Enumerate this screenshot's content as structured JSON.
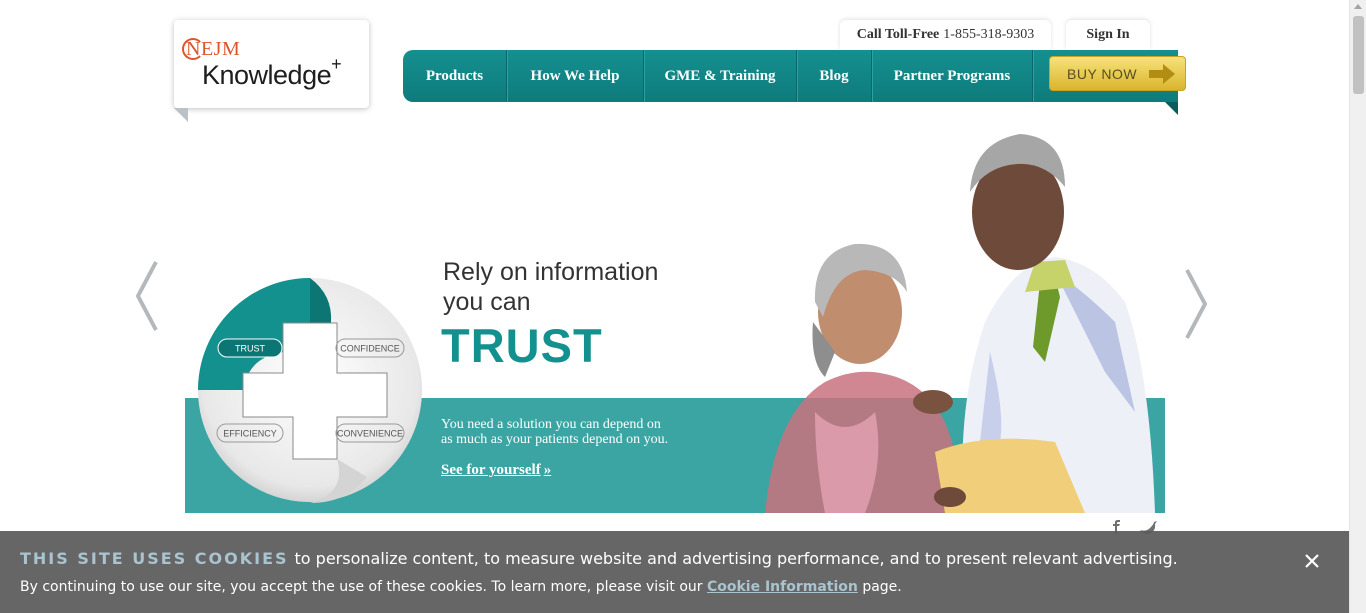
{
  "logo": {
    "brand_top": "NEJM",
    "brand_main": "Knowledge",
    "brand_plus": "+"
  },
  "utility": {
    "call_label": "Call Toll-Free",
    "call_number": "1-855-318-9303",
    "sign_in": "Sign In"
  },
  "nav": {
    "items": [
      {
        "label": "Products"
      },
      {
        "label": "How We Help"
      },
      {
        "label": "GME & Training"
      },
      {
        "label": "Blog"
      },
      {
        "label": "Partner Programs"
      }
    ],
    "buy_now": "BUY NOW"
  },
  "slide": {
    "headline_1": "Rely on information",
    "headline_2": "you can",
    "headline_big": "TRUST",
    "sub_1": "You need a solution you can depend on",
    "sub_2": "as much as your patients depend on you.",
    "cta": "See for yourself",
    "cta_suffix": "»",
    "quadrants": {
      "trust": "TRUST",
      "confidence": "CONFIDENCE",
      "efficiency": "EFFICIENCY",
      "convenience": "CONVENIENCE"
    }
  },
  "cookie": {
    "title": "THIS SITE USES COOKIES",
    "line1": "to personalize content, to measure website and advertising performance, and to present relevant advertising.",
    "line2_pre": "By continuing to use our site, you accept the use of these cookies. To learn more, please visit our",
    "link": "Cookie Information",
    "line2_post": "page."
  },
  "colors": {
    "teal": "#12918f",
    "gold": "#e3c241",
    "brand_orange": "#e0542c"
  },
  "icons": [
    "prev-arrow-icon",
    "next-arrow-icon",
    "buy-arrow-icon",
    "facebook-icon",
    "twitter-icon",
    "close-icon"
  ]
}
